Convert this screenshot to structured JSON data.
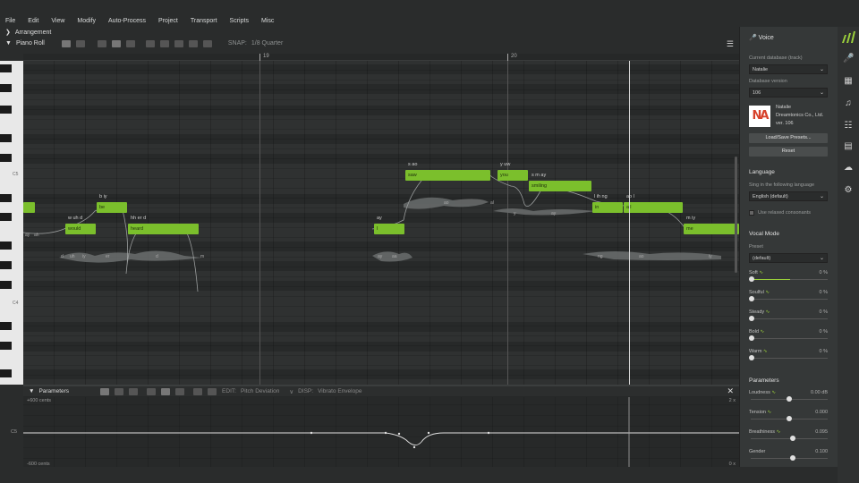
{
  "menu": [
    "File",
    "Edit",
    "View",
    "Modify",
    "Auto-Process",
    "Project",
    "Transport",
    "Scripts",
    "Misc"
  ],
  "arrangement_label": "Arrangement",
  "pianoroll_label": "Piano Roll",
  "snap_label": "SNAP:",
  "snap_value": "1/8 Quarter",
  "ruler": {
    "m19": "19",
    "m20": "20"
  },
  "key_labels": {
    "c5": "C5",
    "c4": "C4"
  },
  "notes": [
    {
      "text": "would"
    },
    {
      "text": "be"
    },
    {
      "text": "heard"
    },
    {
      "text": "I"
    },
    {
      "text": "saw"
    },
    {
      "text": "you"
    },
    {
      "text": "smiling"
    },
    {
      "text": "in"
    },
    {
      "text": "all"
    },
    {
      "text": "me"
    },
    {
      "text": ""
    }
  ],
  "phonemes": [
    "w uh d",
    "b iy",
    "hh er d",
    "ay",
    "s ao",
    "y uw",
    "s m ay",
    "l ih ng",
    "ao l",
    "m iy",
    "ay",
    "ah",
    "aa",
    "ay",
    "ah",
    "aa",
    "s",
    "ao",
    "ao",
    "al",
    "l",
    "y",
    "uw",
    "s",
    "m",
    "ay",
    "ih",
    "ng",
    "l",
    "ih",
    "ng",
    "ao",
    "l",
    "m",
    "iy",
    "uh",
    "d",
    "iy",
    "er",
    "d"
  ],
  "params": {
    "title": "Parameters",
    "edit_label": "EDIT:",
    "edit_value": "Pitch Deviation",
    "disp_label": "DISP:",
    "disp_value": "Vibrato Envelope",
    "top_value": "+600 cents",
    "bottom_value": "-600 cents",
    "right_top": "2 x",
    "right_bottom": "0 x",
    "c5_label": "C5"
  },
  "voice": {
    "title": "Voice",
    "db_label": "Current database (track)",
    "db_value": "Natalie",
    "ver_label": "Database version",
    "ver_value": "106",
    "avatar_text": "NA",
    "singer_name": "Natalie",
    "singer_company": "Dreamtonics Co., Ltd.",
    "singer_ver": "ver. 106",
    "load_btn": "Load/Save Presets...",
    "reset_btn": "Reset",
    "language_title": "Language",
    "sing_label": "Sing in the following language",
    "lang_value": "English (default)",
    "relaxed_label": "Use relaxed consonants",
    "vocal_mode_title": "Vocal Mode",
    "preset_label": "Preset",
    "preset_value": "(default)",
    "modes": [
      {
        "name": "Soft",
        "value": "0 %"
      },
      {
        "name": "Soulful",
        "value": "0 %"
      },
      {
        "name": "Steady",
        "value": "0 %"
      },
      {
        "name": "Bold",
        "value": "0 %"
      },
      {
        "name": "Warm",
        "value": "0 %"
      }
    ],
    "parameters_title": "Parameters",
    "vparams": [
      {
        "name": "Loudness",
        "value": "0.00 dB"
      },
      {
        "name": "Tension",
        "value": "0.000"
      },
      {
        "name": "Breathiness",
        "value": "0.095"
      },
      {
        "name": "Gender",
        "value": "0.100"
      }
    ]
  },
  "colors": {
    "note": "#7bbf2c",
    "accent": "#9bd03b",
    "avatar": "#d7422b"
  }
}
